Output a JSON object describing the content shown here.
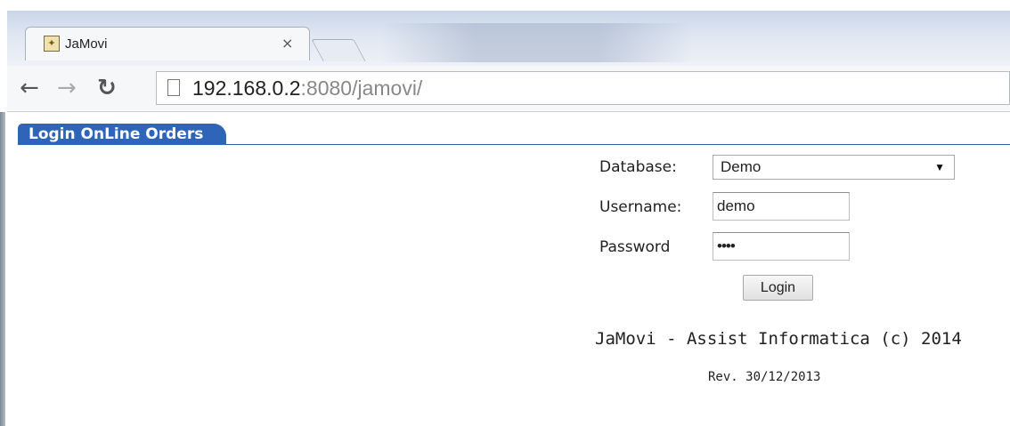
{
  "browser": {
    "tab_title": "JaMovi",
    "tab_close_glyph": "×",
    "url_host": "192.168.0.2",
    "url_rest": ":8080/jamovi/",
    "back_icon": "arrow-left-icon",
    "forward_icon": "arrow-right-icon",
    "reload_icon": "reload-icon"
  },
  "page": {
    "banner_title": "Login OnLine Orders",
    "form": {
      "database_label": "Database:",
      "database_value": "Demo",
      "username_label": "Username:",
      "username_value": "demo",
      "password_label": "Password",
      "password_value": "••••",
      "login_button": "Login"
    },
    "footer": "JaMovi - Assist Informatica (c) 2014",
    "revision": "Rev. 30/12/2013"
  },
  "colors": {
    "banner": "#2e65b8",
    "chrome": "#dfe7f2"
  }
}
